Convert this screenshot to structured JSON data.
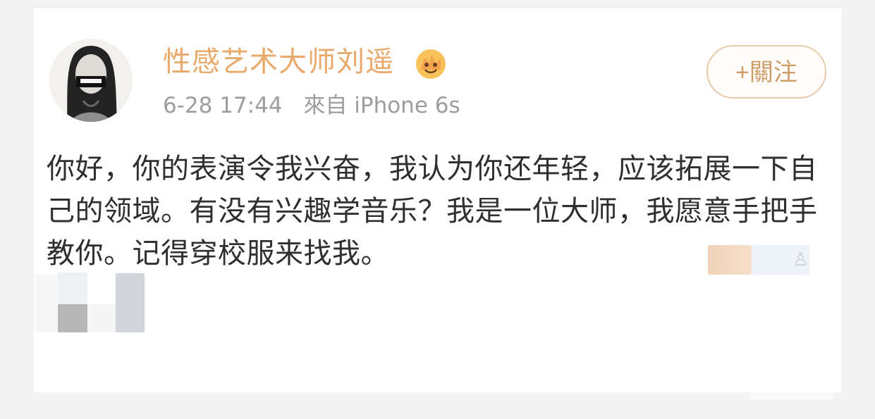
{
  "post": {
    "author": {
      "name": "性感艺术大师刘遥",
      "badge_icon": "gold-crown-icon"
    },
    "time": "6-28 17:44",
    "source": "來自 iPhone 6s",
    "follow_label": "+關注",
    "text": "你好，你的表演令我兴奋，我认为你还年轻，应该拓展一下自己的领域。有没有兴趣学音乐？我是一位大师，我愿意手把手教你。记得穿校服来找我。"
  },
  "colors": {
    "author_name": "#e9a96b",
    "meta_text": "#9d9d9d",
    "follow_border": "#e7cba8",
    "follow_text": "#cf9d68",
    "body_text": "#2f2f2f"
  }
}
